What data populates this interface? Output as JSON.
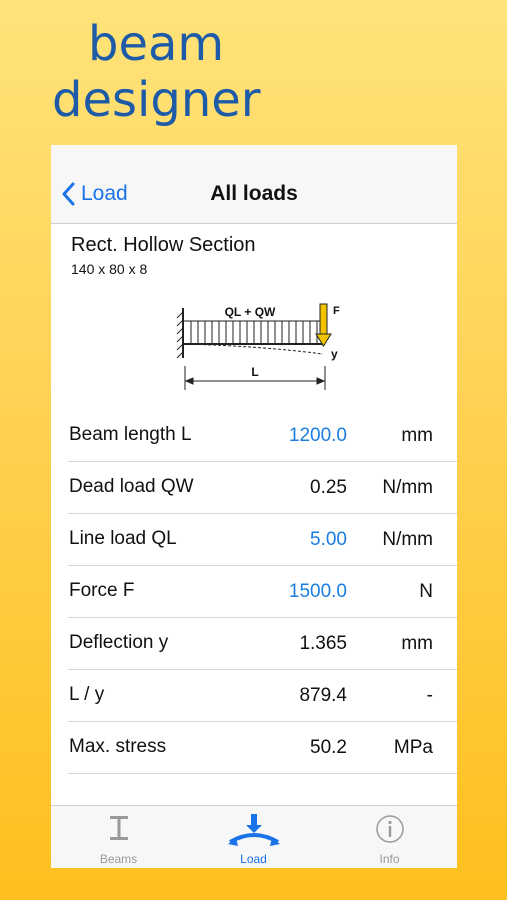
{
  "promo": {
    "title_line1": "beam",
    "title_line2": "designer"
  },
  "navbar": {
    "back_label": "Load",
    "title": "All loads"
  },
  "section": {
    "name": "Rect. Hollow Section",
    "dimensions": "140 x 80 x 8"
  },
  "diagram": {
    "load_label": "QL + QW",
    "force_label": "F",
    "deflection_label": "y",
    "length_label": "L"
  },
  "rows": [
    {
      "label": "Beam length L",
      "value": "1200.0",
      "unit": "mm",
      "editable": true
    },
    {
      "label": "Dead load QW",
      "value": "0.25",
      "unit": "N/mm",
      "editable": false
    },
    {
      "label": "Line load QL",
      "value": "5.00",
      "unit": "N/mm",
      "editable": true
    },
    {
      "label": "Force F",
      "value": "1500.0",
      "unit": "N",
      "editable": true
    },
    {
      "label": "Deflection y",
      "value": "1.365",
      "unit": "mm",
      "editable": false
    },
    {
      "label": "L / y",
      "value": "879.4",
      "unit": "-",
      "editable": false
    },
    {
      "label": "Max. stress",
      "value": "50.2",
      "unit": "MPa",
      "editable": false
    }
  ],
  "tabs": [
    {
      "label": "Beams",
      "icon": "i-beam-icon",
      "active": false
    },
    {
      "label": "Load",
      "icon": "load-icon",
      "active": true
    },
    {
      "label": "Info",
      "icon": "info-icon",
      "active": false
    }
  ],
  "colors": {
    "accent": "#1a73e8",
    "editable_value": "#1a7de0",
    "promo_text": "#1d5aa8",
    "background_top": "#ffe37a",
    "background_bottom": "#ffbf1e",
    "force_arrow": "#f2c400"
  }
}
